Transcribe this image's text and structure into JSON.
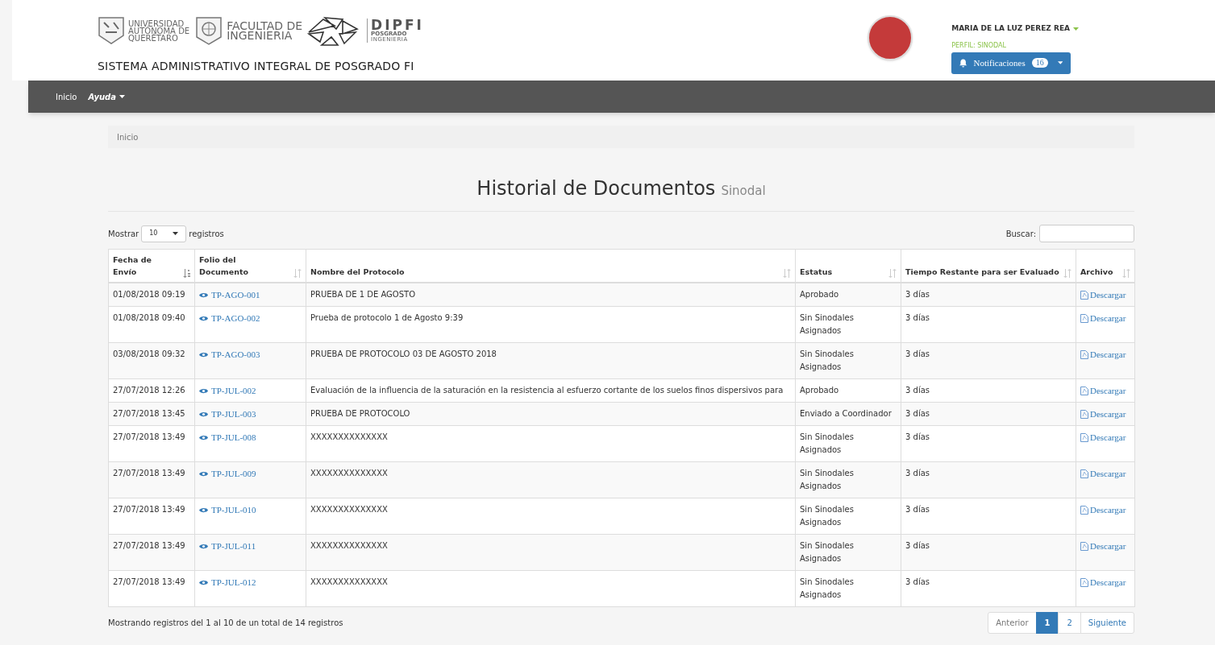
{
  "header": {
    "university": [
      "UNIVERSIDAD",
      "AUTÓNOMA DE",
      "QUERÉTARO"
    ],
    "faculty": [
      "FACULTAD DE",
      "INGENIERIA"
    ],
    "dipfi": {
      "name": "DIPFI",
      "sub": "POSGRADO",
      "sub2": "INGENIERIA"
    },
    "system_title": "SISTEMA ADMINISTRATIVO INTEGRAL DE POSGRADO FI",
    "user": {
      "name": "MARIA DE LA LUZ PEREZ REA",
      "profile": "PERFIL: SINODAL"
    },
    "notifications": {
      "label": "Notificaciones",
      "count": "16"
    }
  },
  "nav": [
    {
      "label": "Inicio",
      "italic": false,
      "dropdown": false
    },
    {
      "label": "Ayuda",
      "italic": true,
      "dropdown": true
    }
  ],
  "breadcrumb": "Inicio",
  "page_title": {
    "main": "Historial de Documentos",
    "sub": "Sinodal"
  },
  "length_control": {
    "before": "Mostrar",
    "value": "10",
    "after": "registros"
  },
  "search_label": "Buscar:",
  "table": {
    "columns": [
      {
        "label": "Fecha de Envío",
        "sorted": true
      },
      {
        "label": "Folio del Documento",
        "sorted": false
      },
      {
        "label": "Nombre del Protocolo",
        "sorted": false
      },
      {
        "label": "Estatus",
        "sorted": false
      },
      {
        "label": "Tiempo Restante para ser Evaluado",
        "sorted": false
      },
      {
        "label": "Archivo",
        "sorted": false
      }
    ],
    "rows": [
      {
        "date": "01/08/2018 09:19",
        "folio": "TP-AGO-001",
        "name": "PRUEBA DE 1 DE AGOSTO",
        "status": "Aprobado",
        "remaining": "3 días",
        "file": "Descargar"
      },
      {
        "date": "01/08/2018 09:40",
        "folio": "TP-AGO-002",
        "name": "Prueba de protocolo 1 de Agosto 9:39",
        "status": "Sin Sinodales Asignados",
        "remaining": "3 días",
        "file": "Descargar"
      },
      {
        "date": "03/08/2018 09:32",
        "folio": "TP-AGO-003",
        "name": "PRUEBA DE PROTOCOLO 03 DE AGOSTO 2018",
        "status": "Sin Sinodales Asignados",
        "remaining": "3 días",
        "file": "Descargar"
      },
      {
        "date": "27/07/2018 12:26",
        "folio": "TP-JUL-002",
        "name": "Evaluación de la influencia de la saturación en la resistencia al esfuerzo cortante de los suelos finos dispersivos para",
        "status": "Aprobado",
        "remaining": "3 días",
        "file": "Descargar"
      },
      {
        "date": "27/07/2018 13:45",
        "folio": "TP-JUL-003",
        "name": "PRUEBA DE PROTOCOLO",
        "status": "Enviado a Coordinador",
        "remaining": "3 días",
        "file": "Descargar"
      },
      {
        "date": "27/07/2018 13:49",
        "folio": "TP-JUL-008",
        "name": "XXXXXXXXXXXXXX",
        "status": "Sin Sinodales Asignados",
        "remaining": "3 días",
        "file": "Descargar"
      },
      {
        "date": "27/07/2018 13:49",
        "folio": "TP-JUL-009",
        "name": "XXXXXXXXXXXXXX",
        "status": "Sin Sinodales Asignados",
        "remaining": "3 días",
        "file": "Descargar"
      },
      {
        "date": "27/07/2018 13:49",
        "folio": "TP-JUL-010",
        "name": "XXXXXXXXXXXXXX",
        "status": "Sin Sinodales Asignados",
        "remaining": "3 días",
        "file": "Descargar"
      },
      {
        "date": "27/07/2018 13:49",
        "folio": "TP-JUL-011",
        "name": "XXXXXXXXXXXXXX",
        "status": "Sin Sinodales Asignados",
        "remaining": "3 días",
        "file": "Descargar"
      },
      {
        "date": "27/07/2018 13:49",
        "folio": "TP-JUL-012",
        "name": "XXXXXXXXXXXXXX",
        "status": "Sin Sinodales Asignados",
        "remaining": "3 días",
        "file": "Descargar"
      }
    ]
  },
  "info": "Mostrando registros del 1 al 10 de un total de 14 registros",
  "pagination": {
    "previous": "Anterior",
    "next": "Siguiente",
    "pages": [
      {
        "label": "1",
        "selected": true
      },
      {
        "label": "2",
        "selected": false
      }
    ]
  }
}
